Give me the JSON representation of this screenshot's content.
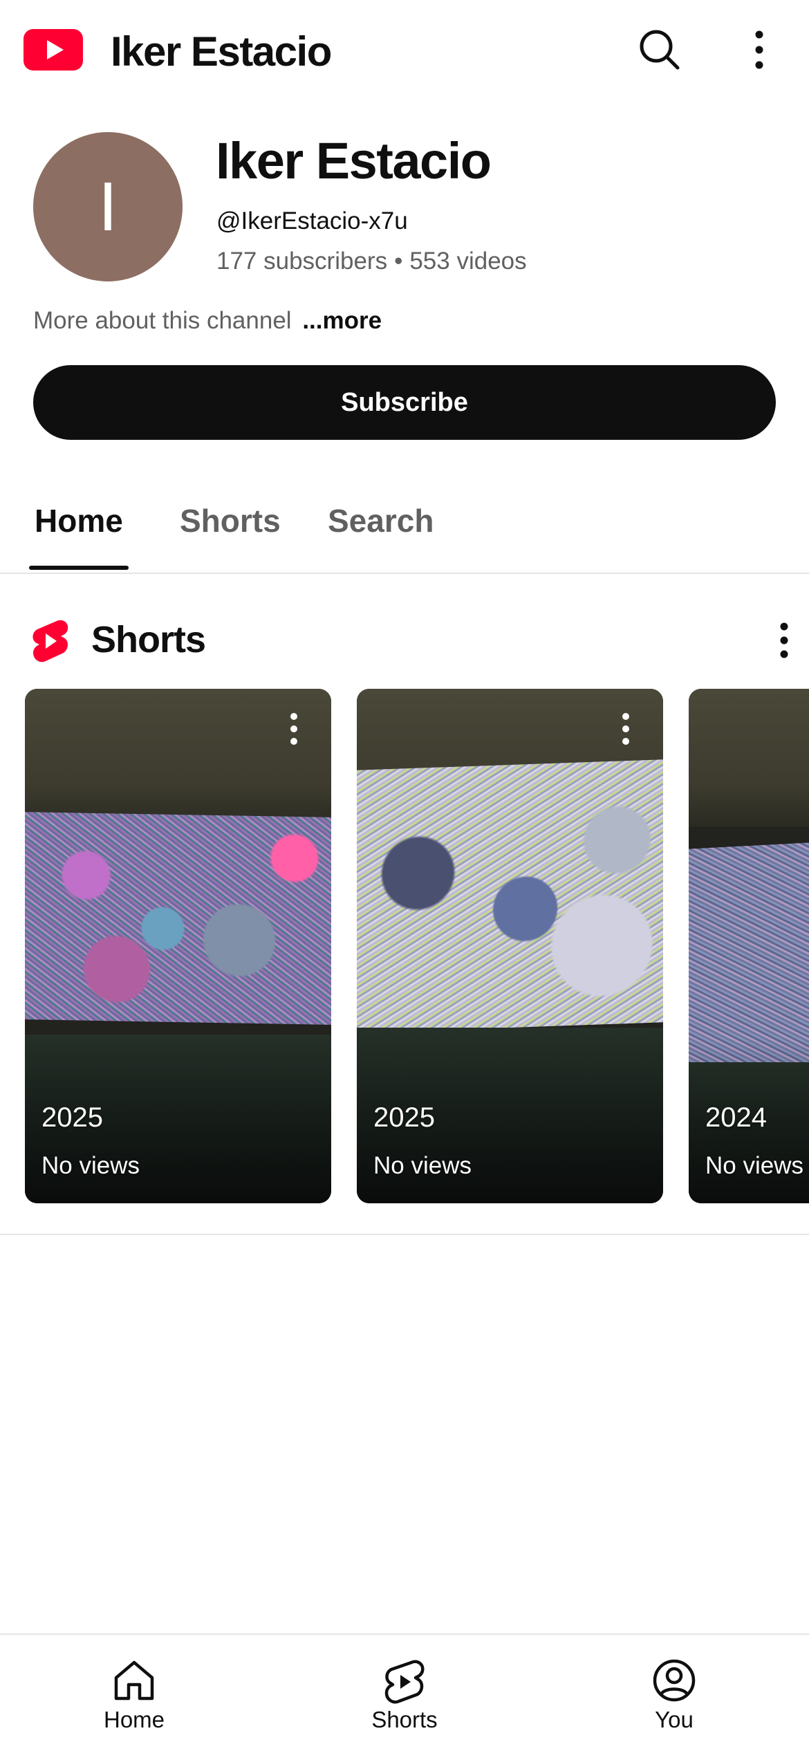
{
  "topbar": {
    "logo_icon": "youtube-logo-icon",
    "title": "Iker Estacio",
    "search_icon": "search-icon",
    "more_icon": "more-vert-icon"
  },
  "channel": {
    "avatar_letter": "I",
    "avatar_color": "#8d6e63",
    "name": "Iker Estacio",
    "handle": "@IkerEstacio-x7u",
    "subscribers": "177 subscribers",
    "separator": "•",
    "videos": "553 videos",
    "about_text": "More about this channel",
    "about_more": "...more",
    "subscribe_label": "Subscribe"
  },
  "tabs": [
    {
      "label": "Home",
      "active": true
    },
    {
      "label": "Shorts",
      "active": false
    },
    {
      "label": "Search",
      "active": false
    }
  ],
  "shorts_shelf": {
    "title": "Shorts",
    "icon": "shorts-logo-icon",
    "accent": "#ff0033",
    "items": [
      {
        "year": "2025",
        "views": "No views"
      },
      {
        "year": "2025",
        "views": "No views"
      },
      {
        "year": "2024",
        "views": "No views"
      }
    ]
  },
  "bottom_nav": [
    {
      "label": "Home",
      "icon": "home-icon"
    },
    {
      "label": "Shorts",
      "icon": "shorts-icon"
    },
    {
      "label": "You",
      "icon": "account-icon"
    }
  ]
}
